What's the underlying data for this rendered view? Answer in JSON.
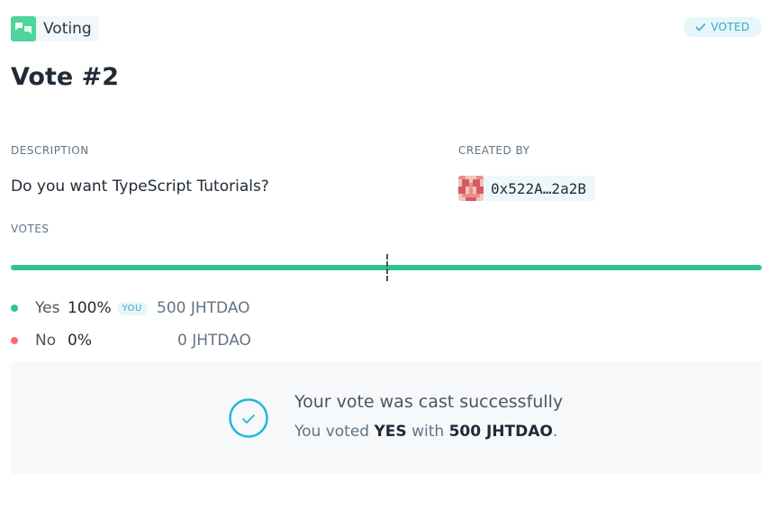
{
  "app": {
    "name": "Voting",
    "accent": "#4fd49c"
  },
  "status_badge": {
    "label": "VOTED",
    "icon": "check-icon",
    "color": "#3aa5c3"
  },
  "vote": {
    "title": "Vote #2",
    "description_label": "DESCRIPTION",
    "description": "Do you want TypeScript Tutorials?",
    "created_by_label": "CREATED BY",
    "creator_address": "0x522A…2a2B",
    "votes_label": "VOTES",
    "yes_share": 1.0
  },
  "options": [
    {
      "name": "Yes",
      "percent": "100%",
      "badge": "YOU",
      "amount": "500 JHTDAO",
      "color": "#30c48d"
    },
    {
      "name": "No",
      "percent": "0%",
      "badge": "",
      "amount": "0 JHTDAO",
      "color": "#ff6969"
    }
  ],
  "confirmation": {
    "title": "Your vote was cast successfully",
    "prefix": "You voted",
    "choice": "YES",
    "with_word": "with",
    "amount": "500 JHTDAO",
    "suffix": ".",
    "icon": "check-circle-icon"
  }
}
